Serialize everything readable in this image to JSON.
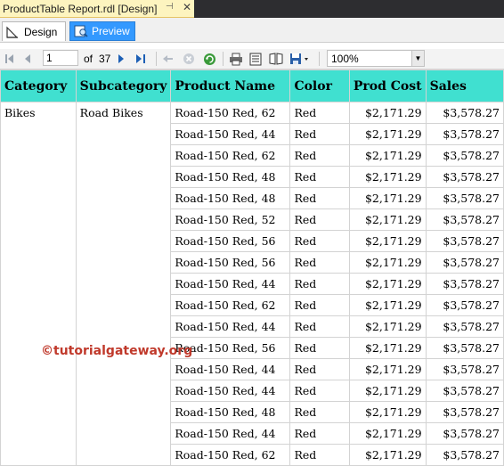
{
  "document_tab": {
    "title": "ProductTable Report.rdl [Design]",
    "pin_icon": "pin-icon",
    "close_icon": "close-icon"
  },
  "view_tabs": [
    {
      "label": "Design",
      "icon": "design-view-icon",
      "active": false
    },
    {
      "label": "Preview",
      "icon": "preview-view-icon",
      "active": true
    }
  ],
  "toolbar": {
    "current_page": "1",
    "of_label": "of",
    "total_pages": "37",
    "zoom": "100%"
  },
  "report": {
    "headers": [
      "Category",
      "Subcategory",
      "Product Name",
      "Color",
      "Prod Cost",
      "Sales"
    ],
    "group_category": "Bikes",
    "group_subcategory": "Road Bikes",
    "rows": [
      [
        "Road-150 Red, 62",
        "Red",
        "$2,171.29",
        "$3,578.27"
      ],
      [
        "Road-150 Red, 44",
        "Red",
        "$2,171.29",
        "$3,578.27"
      ],
      [
        "Road-150 Red, 62",
        "Red",
        "$2,171.29",
        "$3,578.27"
      ],
      [
        "Road-150 Red, 48",
        "Red",
        "$2,171.29",
        "$3,578.27"
      ],
      [
        "Road-150 Red, 48",
        "Red",
        "$2,171.29",
        "$3,578.27"
      ],
      [
        "Road-150 Red, 52",
        "Red",
        "$2,171.29",
        "$3,578.27"
      ],
      [
        "Road-150 Red, 56",
        "Red",
        "$2,171.29",
        "$3,578.27"
      ],
      [
        "Road-150 Red, 56",
        "Red",
        "$2,171.29",
        "$3,578.27"
      ],
      [
        "Road-150 Red, 44",
        "Red",
        "$2,171.29",
        "$3,578.27"
      ],
      [
        "Road-150 Red, 62",
        "Red",
        "$2,171.29",
        "$3,578.27"
      ],
      [
        "Road-150 Red, 44",
        "Red",
        "$2,171.29",
        "$3,578.27"
      ],
      [
        "Road-150 Red, 56",
        "Red",
        "$2,171.29",
        "$3,578.27"
      ],
      [
        "Road-150 Red, 44",
        "Red",
        "$2,171.29",
        "$3,578.27"
      ],
      [
        "Road-150 Red, 44",
        "Red",
        "$2,171.29",
        "$3,578.27"
      ],
      [
        "Road-150 Red, 48",
        "Red",
        "$2,171.29",
        "$3,578.27"
      ],
      [
        "Road-150 Red, 44",
        "Red",
        "$2,171.29",
        "$3,578.27"
      ],
      [
        "Road-150 Red, 62",
        "Red",
        "$2,171.29",
        "$3,578.27"
      ]
    ]
  },
  "watermark": "©tutorialgateway.org",
  "colors": {
    "header_bg": "#40e0d0",
    "tab_highlight": "#fdf4bf",
    "preview_tab": "#3399ff",
    "watermark": "#c0392b"
  }
}
